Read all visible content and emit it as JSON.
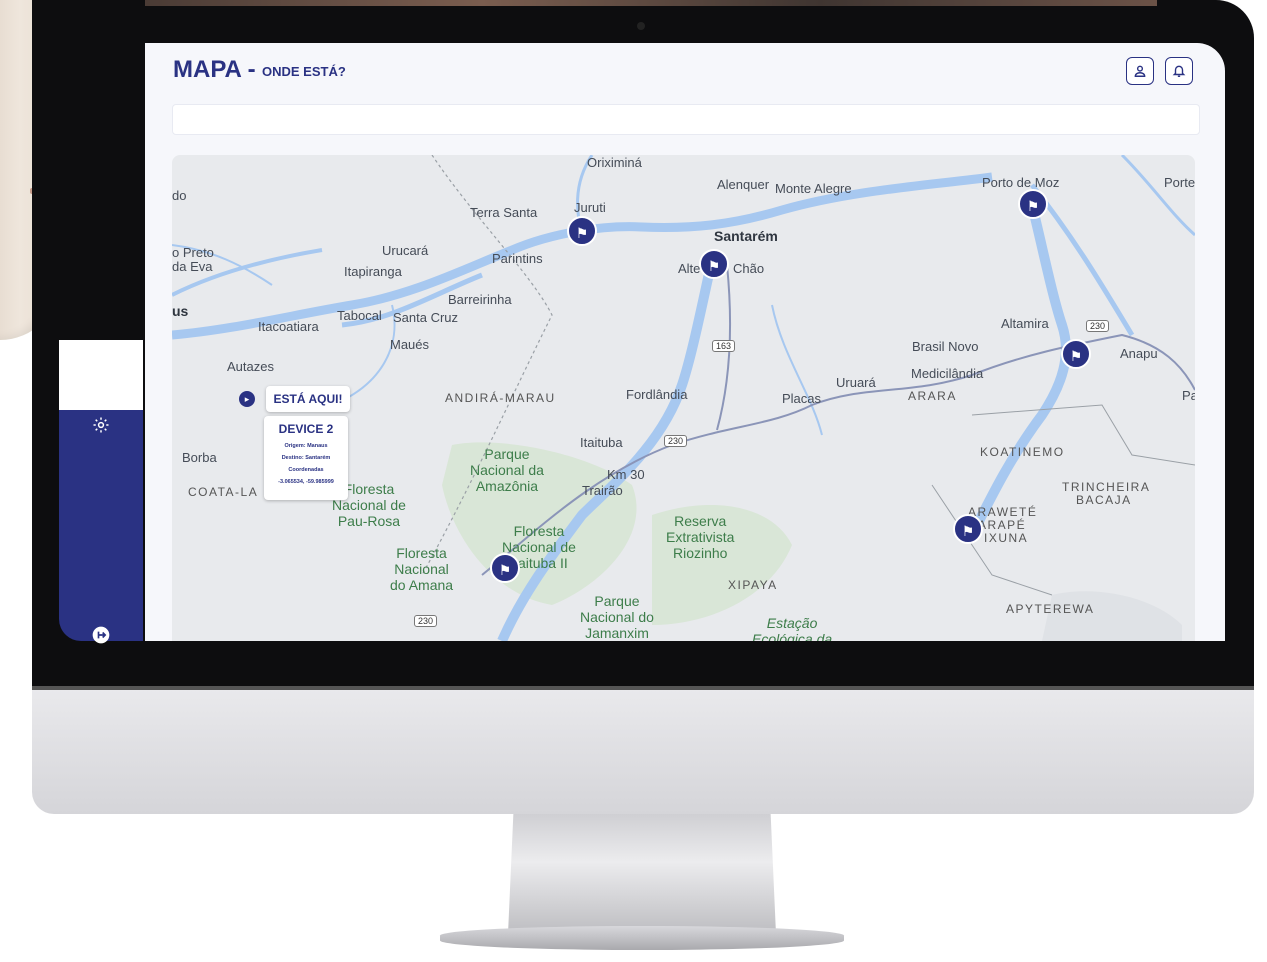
{
  "page": {
    "title": "MAPA -",
    "subtitle": "ONDE ESTÁ?"
  },
  "header": {
    "user_icon": "user-icon",
    "bell_icon": "bell-icon"
  },
  "sidebar": {
    "settings_icon": "gear-icon",
    "logout_icon": "logout-icon"
  },
  "search": {
    "placeholder": ""
  },
  "map": {
    "places": {
      "oriximina": "Oriximiná",
      "alenquer": "Alenquer",
      "monte_alegre": "Monte Alegre",
      "porto_de_moz": "Porto de Moz",
      "porte": "Porte",
      "terra_santa": "Terra Santa",
      "juruti": "Juruti",
      "santarem": "Santarém",
      "alter_do_chao_a": "Alte",
      "alter_do_chao_b": "Chão",
      "do": "do",
      "preto": "o Preto",
      "da_eva": "da Eva",
      "urucara": "Urucará",
      "parintins": "Parintins",
      "itapiranga": "Itapiranga",
      "barreirinha": "Barreirinha",
      "us": "us",
      "itacoatiara": "Itacoatiara",
      "tabocal": "Tabocal",
      "santa_cruz": "Santa Cruz",
      "maues": "Maués",
      "altamira": "Altamira",
      "brasil_novo": "Brasil Novo",
      "anapu": "Anapu",
      "medicilandia": "Medicilândia",
      "uruara": "Uruará",
      "placas": "Placas",
      "pa": "Pa",
      "autazes": "Autazes",
      "fordlandia": "Fordlândia",
      "itaituba": "Itaituba",
      "km30": "Km 30",
      "trairao": "Trairão",
      "borba": "Borba"
    },
    "regions": {
      "andira_marau": "ANDIRÁ-MARAU",
      "arara": "ARARA",
      "koatinemo": "KOATINEMO",
      "trincheira_a": "TRINCHEIRA",
      "trincheira_b": "BACAJA",
      "araweté_a": "ARAWETÉ",
      "araweté_b": "ARAPÉ",
      "araweté_c": "IXUNA",
      "apyterewa": "APYTEREWA",
      "xipaya": "XIPAYA",
      "coata_la": "COATA-LA"
    },
    "parks": {
      "pn_amazonia": "Parque\nNacional da\nAmazônia",
      "fn_pau_rosa": "Floresta\nNacional de\nPau-Rosa",
      "fn_amana": "Floresta\nNacional\ndo Amana",
      "fn_itaituba": "Floresta\nNacional de\nItaituba II",
      "re_riozinho": "Reserva\nExtrativista\nRiozinho",
      "pn_jamanxim": "Parque\nNacional do\nJamanxim",
      "estacao": "Estação\nEcológica da"
    },
    "shields": {
      "br163": "163",
      "br230_a": "230",
      "br230_b": "230",
      "br230_c": "230"
    },
    "marker_icon": "tower-icon"
  },
  "tooltip": {
    "label": "ESTÁ AQUI!",
    "device_name": "DEVICE 2",
    "origin": "Origem: Manaus",
    "destination": "Destino: Santarém",
    "coords_label": "Coordenadas",
    "coords": "-3.065534, -59.985999",
    "pin_icon": "location-icon"
  },
  "colors": {
    "brand": "#2a3283",
    "map_water": "#a7c8f0",
    "map_land": "#e8eaed",
    "park_text": "#3d7d4a"
  }
}
